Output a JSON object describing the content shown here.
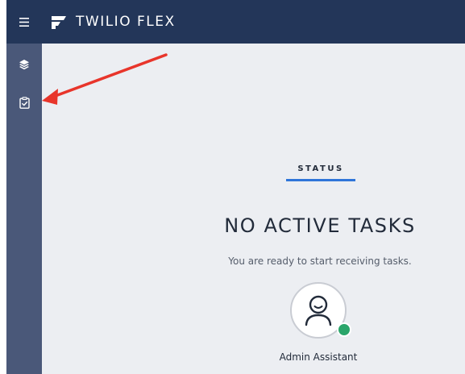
{
  "header": {
    "brand_title": "TWILIO FLEX",
    "menu_icon": "hamburger-menu-icon",
    "logo_icon": "twilio-flex-logo-icon"
  },
  "sidebar": {
    "items": [
      {
        "icon": "layers-icon",
        "tooltip": ""
      },
      {
        "icon": "clipboard-check-icon",
        "tooltip": ""
      }
    ]
  },
  "main": {
    "tab_label": "STATUS",
    "headline": "NO ACTIVE TASKS",
    "subtext": "You are ready to start receiving tasks.",
    "agent": {
      "name": "Admin Assistant",
      "presence_color": "#2aa56a"
    }
  },
  "annotation": {
    "arrow_color": "#e8352b"
  },
  "colors": {
    "topbar": "#233659",
    "sidebar": "#4a5879",
    "content_bg": "#eceef2",
    "accent": "#2f75d9"
  }
}
